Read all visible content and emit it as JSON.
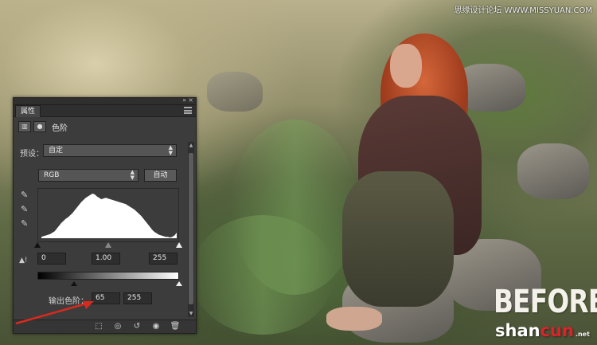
{
  "watermark_top": "思缘设计论坛 WWW.MISSYUAN.COM",
  "photo_label": "BEFORE",
  "site_logo": {
    "part1": "shan",
    "part2": "cun",
    "sub": ".net"
  },
  "panel": {
    "tab_label": "属性",
    "title": "色阶",
    "preset_label": "预设：",
    "preset_value": "自定",
    "channel_value": "RGB",
    "auto_button": "自动",
    "input_black": "0",
    "input_gamma": "1.00",
    "input_white": "255",
    "output_label": "输出色阶：",
    "output_black": "65",
    "output_white": "255"
  },
  "icons": {
    "collapse": "double-chevron-right-icon",
    "close": "close-icon",
    "menu": "panel-menu-icon",
    "levels": "levels-icon",
    "mask": "mask-icon",
    "eyedroppers": [
      "black-point-eyedropper-icon",
      "gray-point-eyedropper-icon",
      "white-point-eyedropper-icon"
    ],
    "bottom": [
      "clip-to-layer-icon",
      "view-previous-icon",
      "reset-icon",
      "visibility-eye-icon",
      "delete-icon"
    ]
  },
  "colors": {
    "panel_bg": "#3c3c3c",
    "annotation_arrow": "#d62a1f"
  },
  "histogram_profile": [
    2,
    3,
    4,
    5,
    6,
    8,
    10,
    14,
    18,
    22,
    25,
    28,
    30,
    33,
    36,
    40,
    44,
    48,
    52,
    55,
    58,
    60,
    62,
    64,
    63,
    60,
    58,
    56,
    57,
    58,
    57,
    56,
    55,
    54,
    53,
    52,
    51,
    50,
    49,
    47,
    45,
    43,
    41,
    38,
    35,
    32,
    28,
    24,
    20,
    16,
    12,
    9,
    7,
    5,
    4,
    3,
    2,
    2,
    1,
    2,
    4,
    8
  ]
}
